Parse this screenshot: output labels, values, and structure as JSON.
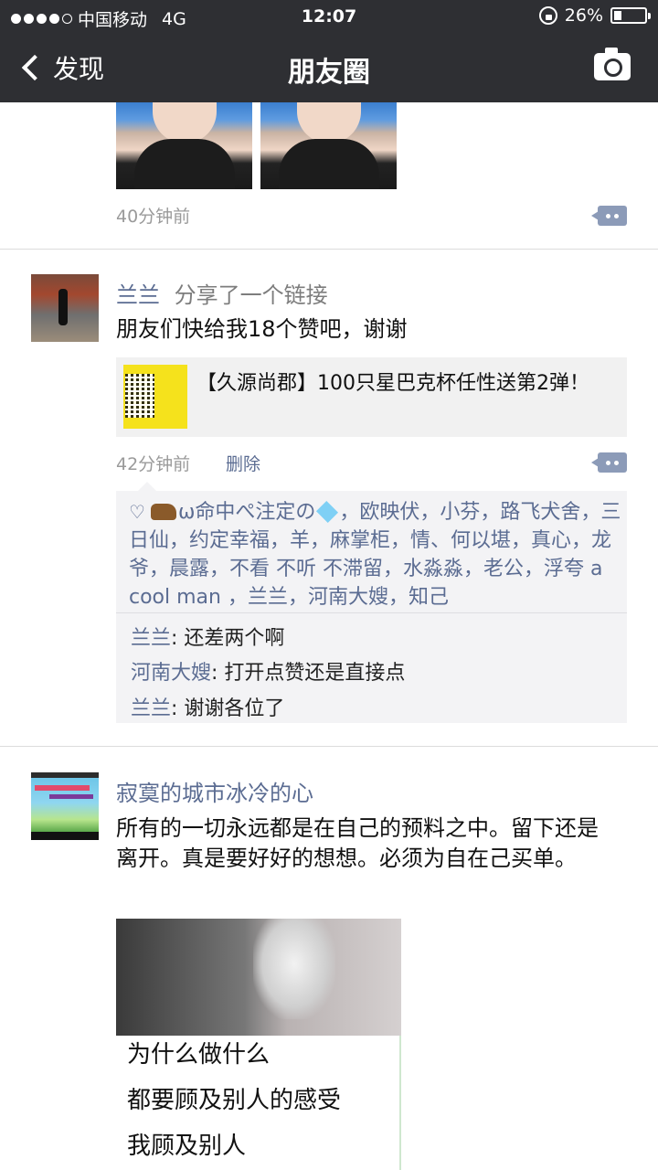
{
  "status": {
    "carrier": "中国移动",
    "network": "4G",
    "time": "12:07",
    "battery_text": "26%",
    "battery_level": 0.26
  },
  "nav": {
    "back_label": "发现",
    "title": "朋友圈"
  },
  "post1": {
    "time": "40分钟前"
  },
  "post2": {
    "name": "兰兰",
    "action": "分享了一个链接",
    "text": "朋友们快给我18个赞吧，谢谢",
    "link_title": "【久源尚郡】100只星巴克杯任性送第2弹！",
    "time": "42分钟前",
    "delete_label": "删除",
    "likes_text_after_icons": "，欧映伏，小芬，路飞犬舍，三日仙，约定幸福，羊，麻掌柜，情、何以堪，真心，龙爷，晨露，不看 不听 不滞留，水淼淼，老公，浮夸 a  cool man ，兰兰，河南大嫂，知己",
    "likes_first": "ω命中ぺ注定の",
    "comments": [
      {
        "who": "兰兰",
        "text": ": 还差两个啊"
      },
      {
        "who": "河南大嫂",
        "text": ": 打开点赞还是直接点"
      },
      {
        "who": "兰兰",
        "text": ": 谢谢各位了"
      }
    ]
  },
  "post3": {
    "name": "寂寞的城市冰冷的心",
    "text": "所有的一切永远都是在自己的预料之中。留下还是离开。真是要好好的想想。必须为自在己买单。",
    "image_lines": [
      "为什么做什么",
      "都要顾及别人的感受",
      "我顾及别人"
    ]
  },
  "colors": {
    "nav_bg": "#2e2f33",
    "link_blue": "#5b6c92",
    "likes_bg": "#f3f3f5"
  }
}
